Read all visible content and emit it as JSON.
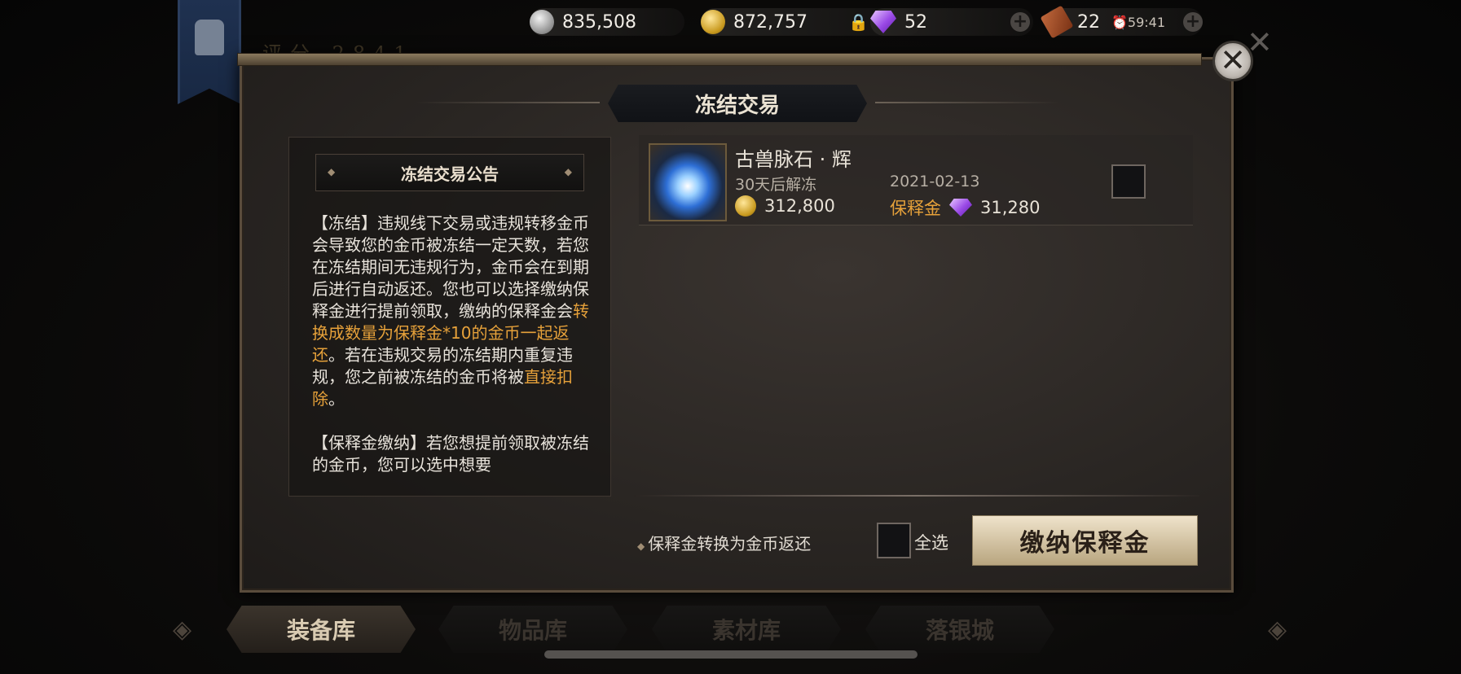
{
  "header": {
    "silver": "835,508",
    "gold": "872,757",
    "gems": "52",
    "tickets": "22",
    "timer": "59:41",
    "score_ghost": "评分 2841"
  },
  "dialog": {
    "title": "冻结交易",
    "close_label": "✕"
  },
  "notice": {
    "title": "冻结交易公告",
    "p1_a": "【冻结】违规线下交易或违规转移金币会导致您的金币被冻结一定天数，若您在冻结期间无违规行为，金币会在到期后进行自动返还。您也可以选择缴纳保释金进行提前领取，缴纳的保释金会",
    "p1_hl": "转换成数量为保释金*10的金币一起返还",
    "p1_b": "。若在违规交易的冻结期内重复违规，您之前被冻结的金币将被",
    "p1_hl2": "直接扣除",
    "p1_c": "。",
    "p2": "【保释金缴纳】若您想提前领取被冻结的金币，您可以选中想要"
  },
  "items": [
    {
      "name": "古兽脉石 · 辉",
      "unfreeze": "30天后解冻",
      "date": "2021-02-13",
      "gold": "312,800",
      "bail_label": "保释金",
      "bail": "31,280"
    }
  ],
  "footer": {
    "note": "保释金转换为金币返还",
    "select_all": "全选",
    "pay_button": "缴纳保释金"
  },
  "tabs": [
    "装备库",
    "物品库",
    "素材库",
    "落银城"
  ],
  "colors": {
    "accent": "#e6a13a",
    "button_bg": "#d1c1a1"
  }
}
